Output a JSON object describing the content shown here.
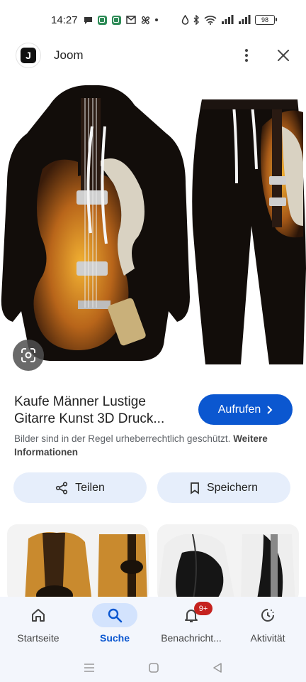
{
  "status_bar": {
    "time": "14:27",
    "battery": "98"
  },
  "app": {
    "title": "Joom",
    "logo_letter": "J"
  },
  "icons": {
    "more": "more-vert-icon",
    "close": "close-icon",
    "lens": "google-lens-icon",
    "visit_arrow": "chevron-right-icon",
    "share": "share-icon",
    "save": "bookmark-icon",
    "home": "home-icon",
    "search": "search-icon",
    "notifications": "bell-icon",
    "activity": "activity-icon"
  },
  "result": {
    "title_line1": "Kaufe Männer Lustige",
    "title_line2": "Gitarre Kunst 3D Druck...",
    "visit_label": "Aufrufen",
    "copyright_text": "Bilder sind in der Regel urheberrechtlich geschützt.",
    "more_info_link": "Weitere Informationen"
  },
  "actions": {
    "share_label": "Teilen",
    "save_label": "Speichern"
  },
  "bottom_nav": {
    "items": [
      {
        "label": "Startseite",
        "active": false
      },
      {
        "label": "Suche",
        "active": true
      },
      {
        "label": "Benachricht...",
        "active": false,
        "badge": "9+"
      },
      {
        "label": "Aktivität",
        "active": false
      }
    ]
  },
  "colors": {
    "accent": "#0b57d0",
    "chip_bg": "#e6eefb",
    "badge": "#c5221f"
  }
}
